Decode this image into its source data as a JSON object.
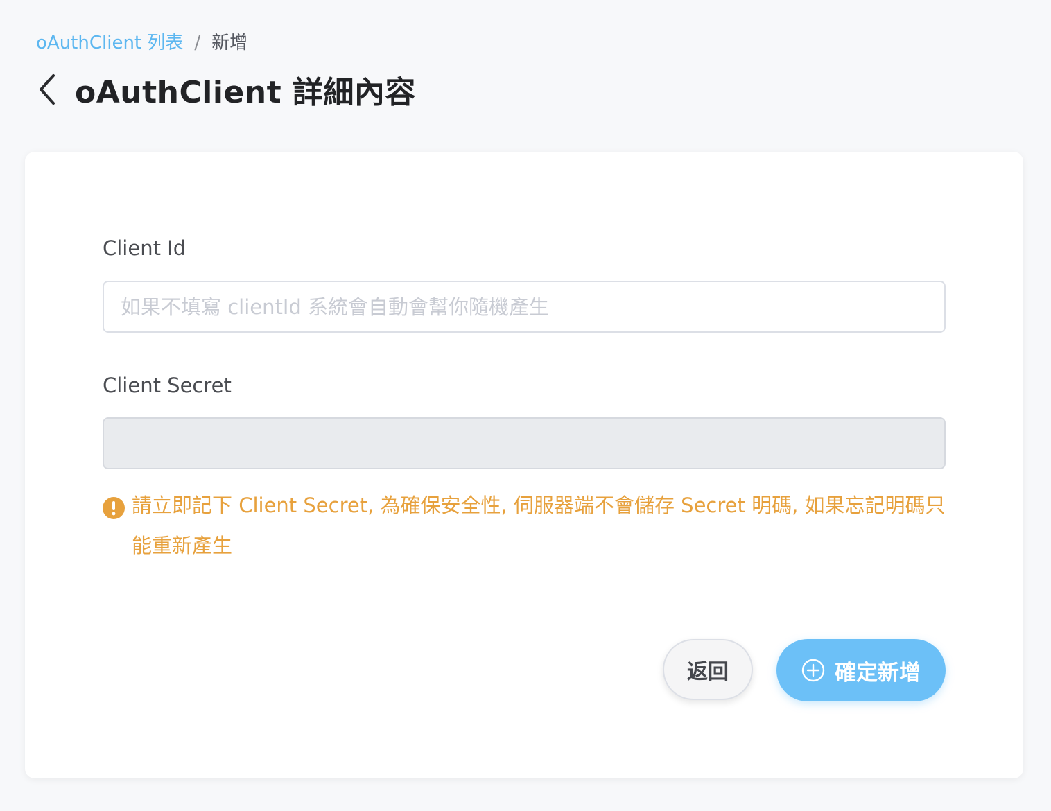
{
  "breadcrumb": {
    "items": [
      {
        "label": "oAuthClient 列表"
      },
      {
        "label": "新增"
      }
    ],
    "separator": "/"
  },
  "header": {
    "back_icon": "chevron-left-icon",
    "title": "oAuthClient 詳細內容"
  },
  "form": {
    "client_id": {
      "label": "Client Id",
      "value": "",
      "placeholder": "如果不填寫 clientId 系統會自動會幫你隨機產生"
    },
    "client_secret": {
      "label": "Client Secret",
      "value": "",
      "disabled": true
    },
    "warning": {
      "icon": "exclamation-circle-icon",
      "text": "請立即記下 Client Secret, 為確保安全性, 伺服器端不會儲存 Secret 明碼, 如果忘記明碼只能重新產生"
    }
  },
  "actions": {
    "back_label": "返回",
    "confirm_label": "確定新增",
    "confirm_icon": "plus-circle-icon"
  },
  "colors": {
    "accent": "#6cc0f7",
    "link": "#5db7f0",
    "warning": "#e7a13d",
    "background": "#f7f8fa"
  }
}
